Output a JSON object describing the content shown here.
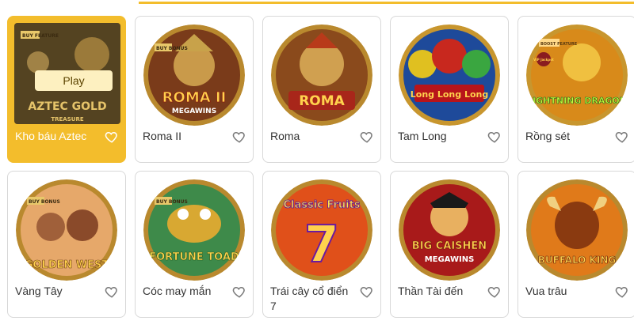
{
  "play_label": "Play",
  "colors": {
    "accent": "#f3bd2c",
    "card_border": "#d8d8d8",
    "heart_stroke": "#7a7a7a"
  },
  "games": [
    {
      "title": "Kho báu Aztec",
      "logo": "AZTEC GOLD",
      "sublogo": "TREASURE",
      "badge": "BUY FEATURE"
    },
    {
      "title": "Roma II",
      "logo": "ROMA II",
      "sublogo": "MEGAWINS",
      "badge": "BUY BONUS"
    },
    {
      "title": "Roma",
      "logo": "ROMA"
    },
    {
      "title": "Tam Long",
      "logo": "Long Long Long"
    },
    {
      "title": "Rồng sét",
      "logo": "LIGHTNING DRAGON",
      "badge": "BOOST FEATURE",
      "badge2": "VIP Jackpot"
    },
    {
      "title": "Vàng Tây",
      "logo": "GOLDEN WEST",
      "badge": "BUY BONUS"
    },
    {
      "title": "Cóc may mắn",
      "logo": "FORTUNE TOAD",
      "badge": "BUY BONUS"
    },
    {
      "title": "Trái cây cổ điển 7",
      "logo": "Classic Fruits",
      "sublogo": "7"
    },
    {
      "title": "Thần Tài đến",
      "logo": "BIG CAISHEN",
      "sublogo": "MEGAWINS"
    },
    {
      "title": "Vua trâu",
      "logo": "BUFFALO KING"
    }
  ]
}
